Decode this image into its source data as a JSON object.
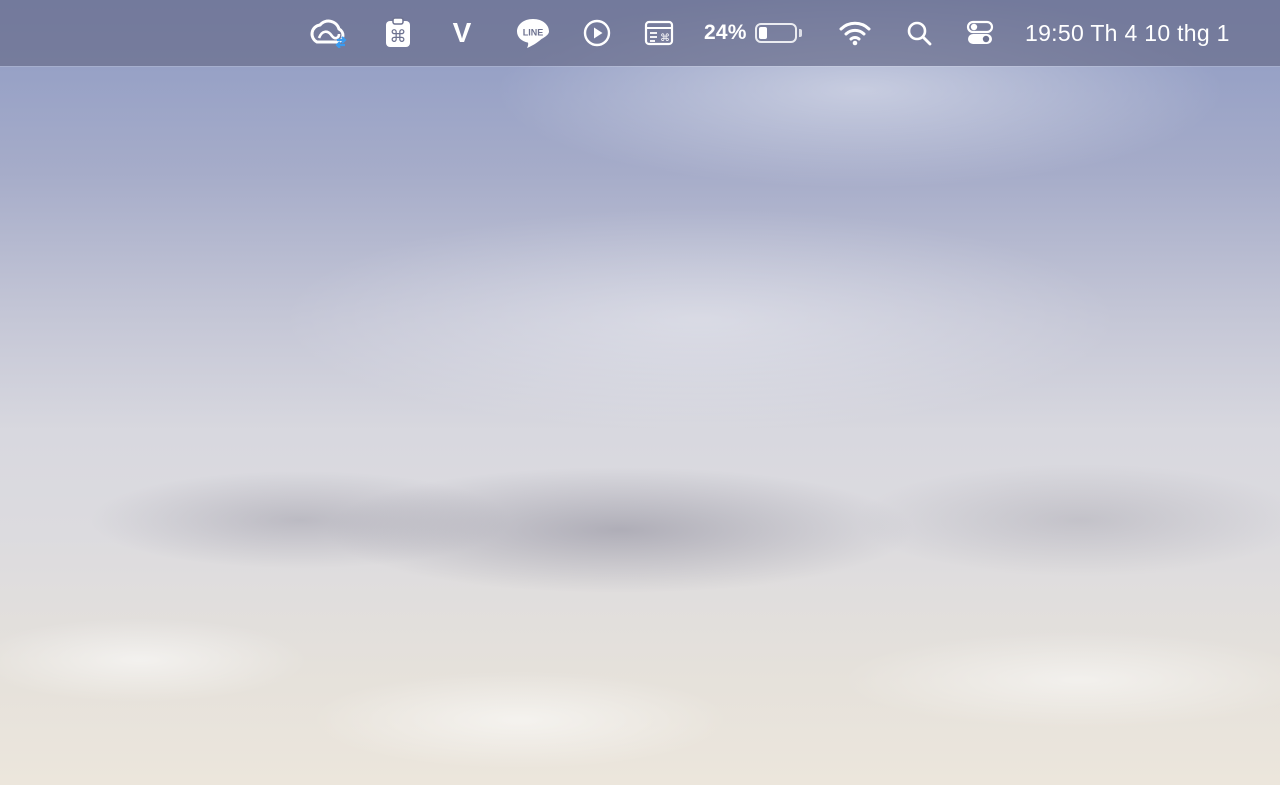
{
  "menubar": {
    "battery": {
      "percent_label": "24%",
      "level": 0.24
    },
    "clock": "19:50 Th 4 10 thg 1",
    "icons": [
      "creative-cloud-sync-icon",
      "command-clipboard-icon",
      "v-app-icon",
      "line-messenger-icon",
      "play-circle-icon",
      "keyboard-shortcuts-window-icon",
      "wifi-icon",
      "spotlight-search-icon",
      "control-center-icon"
    ],
    "line_icon_text": "LINE",
    "v_icon_text": "V"
  },
  "colors": {
    "menubar_bg": "#696e8c",
    "icon": "#ffffff",
    "sky_top": "#8d9ac4",
    "sky_bottom": "#ece6dc"
  }
}
